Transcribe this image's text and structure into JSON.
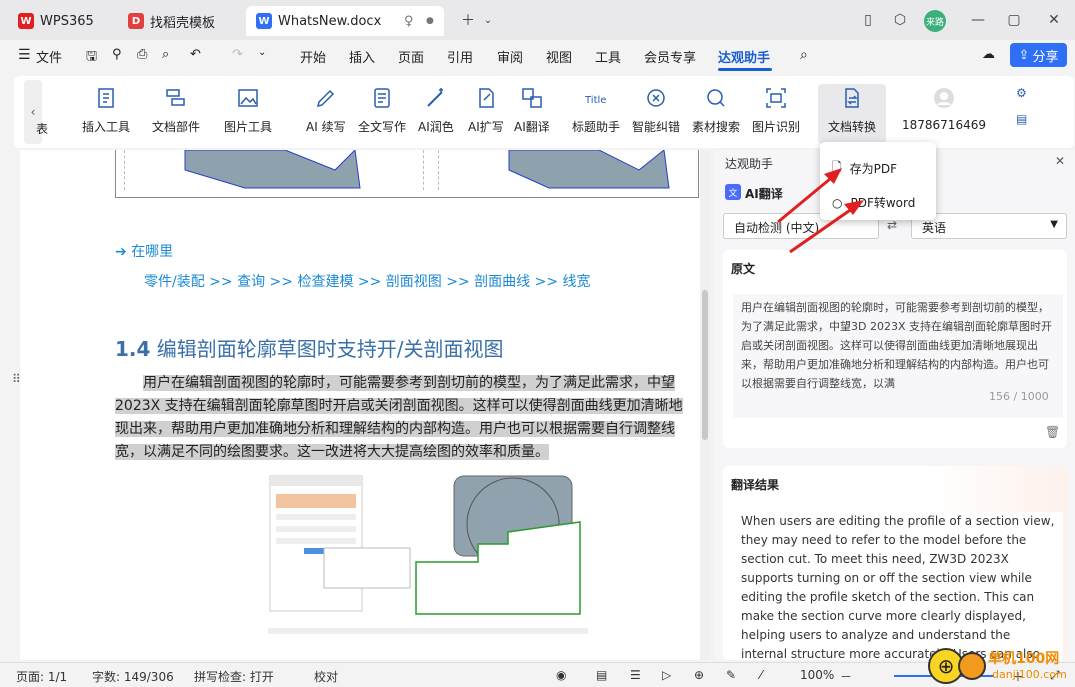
{
  "tabs": [
    {
      "label": "WPS365"
    },
    {
      "label": "找稻壳模板"
    },
    {
      "label": "WhatsNew.docx"
    }
  ],
  "menu": {
    "file": "文件",
    "items": [
      "开始",
      "插入",
      "页面",
      "引用",
      "审阅",
      "视图",
      "工具",
      "会员专享",
      "达观助手"
    ],
    "share": "分享"
  },
  "ribbon": {
    "items": [
      "插入工具",
      "文档部件",
      "图片工具",
      "AI 续写",
      "全文写作",
      "AI润色",
      "AI扩写",
      "AI翻译",
      "标题助手",
      "智能纠错",
      "素材搜索",
      "图片识别",
      "文档转换"
    ],
    "account": "18786716469",
    "partial": "表"
  },
  "popup": {
    "items": [
      "存为PDF",
      "PDF转word"
    ]
  },
  "doc": {
    "where": "在哪里",
    "breadcrumb": "零件/装配 >> 查询 >> 检查建模 >> 剖面视图 >> 剖面曲线 >> 线宽",
    "heading_num": "1.4",
    "heading": "编辑剖面轮廓草图时支持开/关剖面视图",
    "para_lines": [
      "用户在编辑剖面视图的轮廓时，可能需要参考到剖切前的模型，为了满足此需求，中望",
      "2023X 支持在编辑剖面轮廓草图时开启或关闭剖面视图。这样可以使得剖面曲线更加清晰地",
      "现出来，帮助用户更加准确地分析和理解结构的内部构造。用户也可以根据需要自行调整线",
      "宽，以满足不同的绘图要求。这一改进将大大提高绘图的效率和质量。"
    ]
  },
  "sidebar": {
    "title": "达观助手",
    "ai_translate": "AI翻译",
    "src_lang": "自动检测 (中文)",
    "tgt_lang": "英语",
    "original_label": "原文",
    "original_text": "用户在编辑剖面视图的轮廓时，可能需要参考到剖切前的模型，为了满足此需求，中望3D 2023X 支持在编辑剖面轮廓草图时开启或关闭剖面视图。这样可以使得剖面曲线更加清晰地展现出来，帮助用户更加准确地分析和理解结构的内部构造。用户也可以根据需要自行调整线宽，以满",
    "counter": "156 / 1000",
    "result_label": "翻译结果",
    "result_text": "When users are editing the profile of a section view, they may need to refer to the model before the section cut. To meet this need, ZW3D 2023X supports turning on or off the section view while editing the profile sketch of the section. This can make the section curve more clearly displayed, helping users to analyze and understand the internal structure more accurately. Users can also adjust the"
  },
  "status": {
    "page": "页面: 1/1",
    "words": "字数: 149/306",
    "spell": "拼写检查: 打开",
    "proof": "校对",
    "zoom": "100%"
  },
  "watermark": {
    "line1": "单机100网",
    "line2": "danji100.com"
  },
  "colors": {
    "accent": "#1a5fd1",
    "share": "#2f6ff5",
    "arrow": "#e02020"
  }
}
